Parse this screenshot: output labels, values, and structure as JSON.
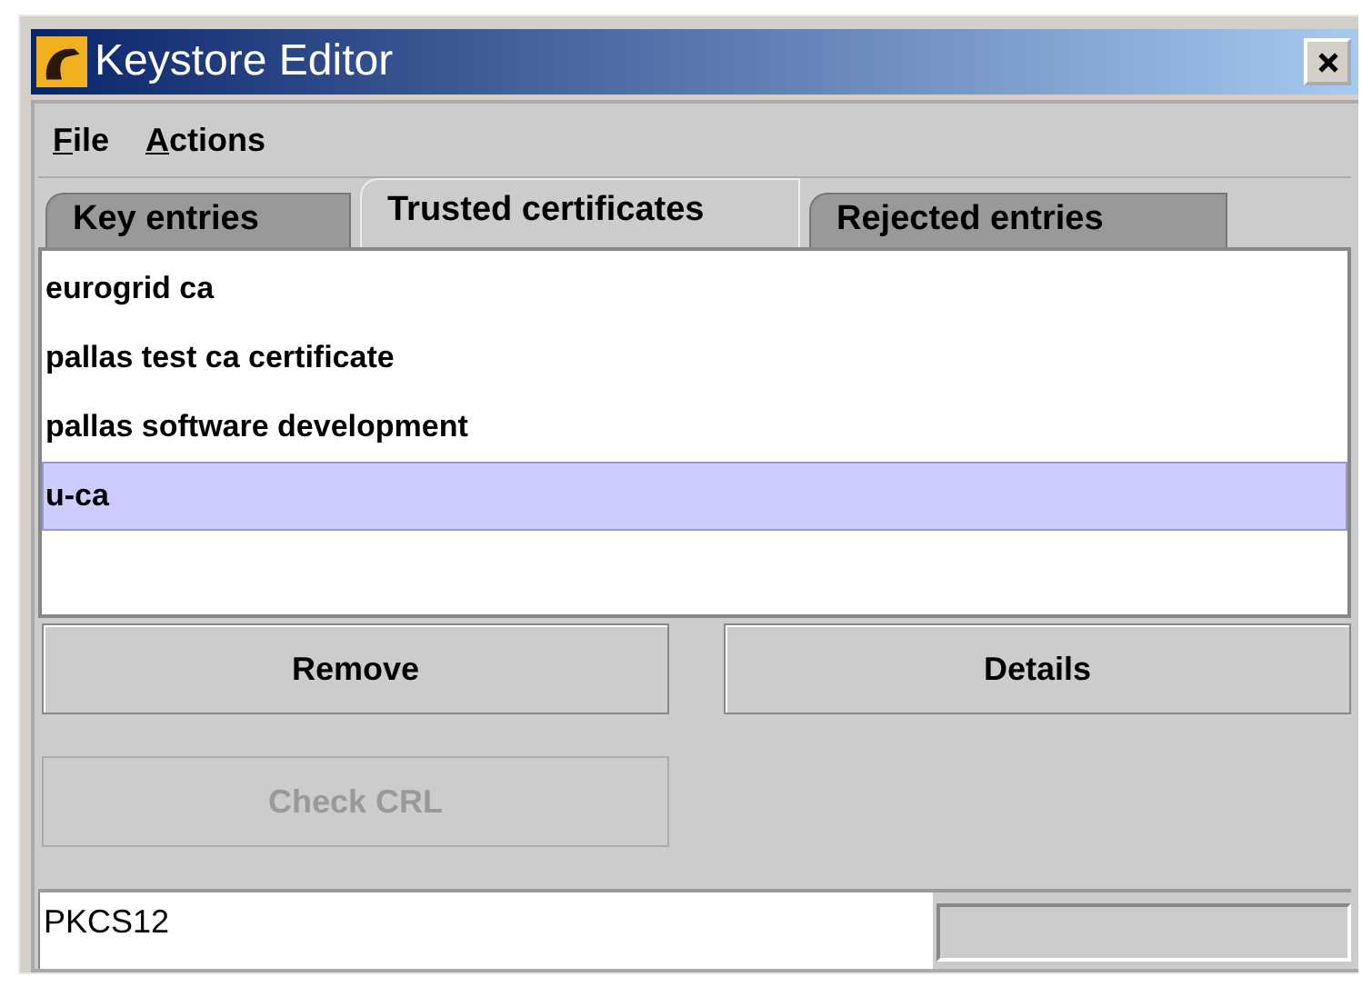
{
  "window": {
    "title": "Keystore Editor"
  },
  "menu": [
    {
      "label": "File"
    },
    {
      "label": "Actions"
    }
  ],
  "tabs": [
    {
      "label": "Key entries",
      "selected": false
    },
    {
      "label": "Trusted certificates",
      "selected": true
    },
    {
      "label": "Rejected entries",
      "selected": false
    }
  ],
  "list": [
    {
      "label": "eurogrid ca",
      "selected": false
    },
    {
      "label": "pallas test ca certificate",
      "selected": false
    },
    {
      "label": "pallas software development",
      "selected": false
    },
    {
      "label": "u-ca",
      "selected": true
    }
  ],
  "buttons": [
    {
      "label": "Remove",
      "disabled": false
    },
    {
      "label": "Details",
      "disabled": false
    },
    {
      "label": "Check CRL",
      "disabled": true
    }
  ],
  "status_bar": {
    "text": "PKCS12"
  }
}
